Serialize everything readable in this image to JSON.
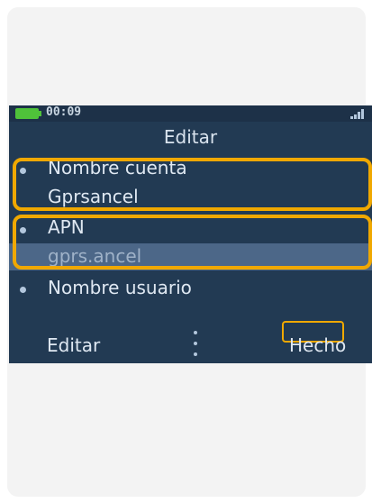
{
  "status_bar": {
    "time": "00:09",
    "battery_color": "#4fc23a",
    "signal_icon": "signal-bars-icon"
  },
  "screen": {
    "title": "Editar",
    "fields": [
      {
        "label": "Nombre cuenta",
        "value": "Gprsancel"
      },
      {
        "label": "APN",
        "value": "gprs.ancel"
      },
      {
        "label": "Nombre usuario"
      }
    ]
  },
  "softkeys": {
    "left": "Editar",
    "right": "Hecho"
  },
  "colors": {
    "highlight": "#f0a800",
    "selection": "#4c6788",
    "screen_bg": "#223a53"
  }
}
